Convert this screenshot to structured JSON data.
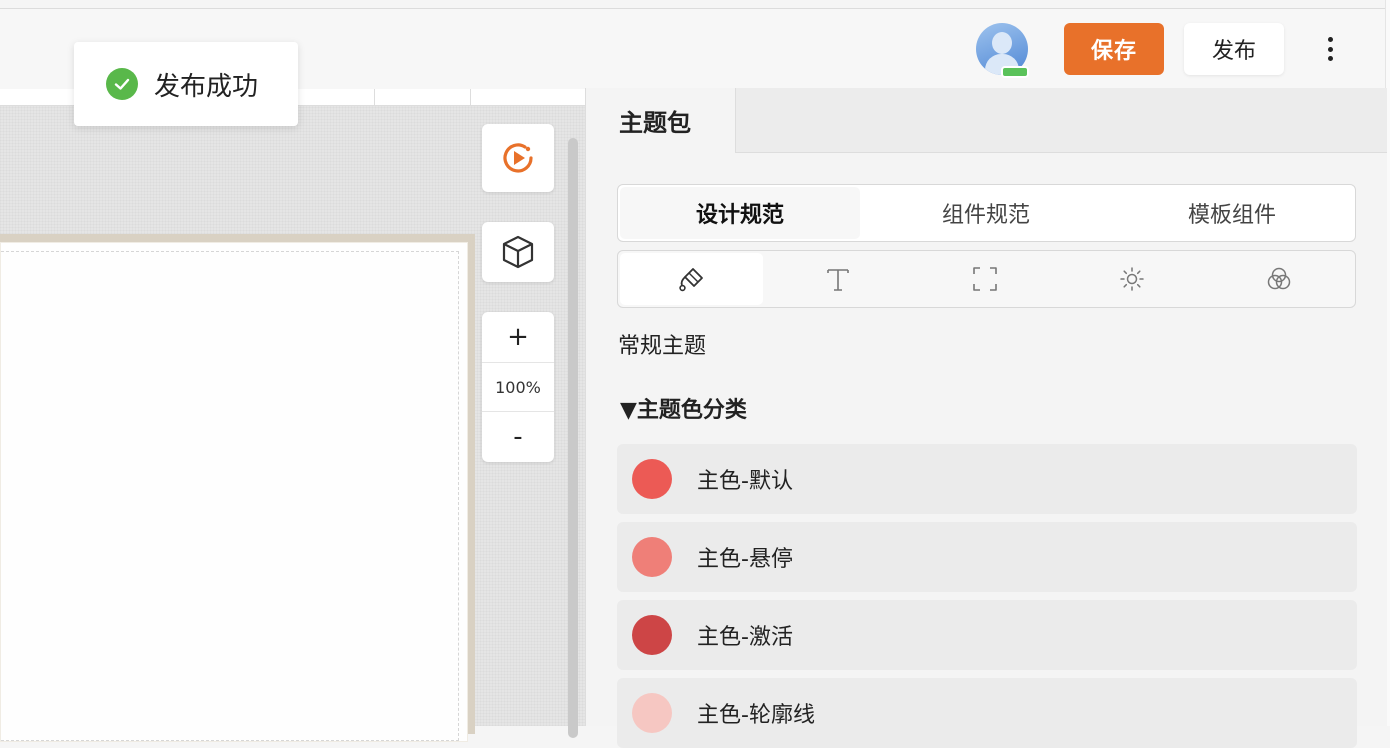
{
  "header": {
    "save_label": "保存",
    "publish_label": "发布",
    "more_icon": "more-vertical-icon",
    "avatar_icon": "user-avatar-icon"
  },
  "toast": {
    "message": "发布成功",
    "icon": "check-circle-icon"
  },
  "canvas": {
    "tools": {
      "preview_icon": "play-preview-icon",
      "model_icon": "cube-icon"
    },
    "zoom": {
      "plus": "+",
      "level": "100%",
      "minus": "-"
    }
  },
  "panel": {
    "tab": "主题包",
    "segments": [
      "设计规范",
      "组件规范",
      "模板组件"
    ],
    "active_segment": "设计规范",
    "icon_tabs": [
      "paint-bucket-icon",
      "text-icon",
      "frame-icon",
      "brightness-icon",
      "color-blend-icon"
    ],
    "theme_label": "常规主题",
    "category_label": "▼主题色分类",
    "colors": [
      {
        "name": "主色-默认",
        "color": "#ec5a55"
      },
      {
        "name": "主色-悬停",
        "color": "#ef7f78"
      },
      {
        "name": "主色-激活",
        "color": "#cd4546"
      },
      {
        "name": "主色-轮廓线",
        "color": "#f6c7c2"
      }
    ]
  },
  "colors": {
    "accent": "#e8712a",
    "success": "#59b84a"
  }
}
